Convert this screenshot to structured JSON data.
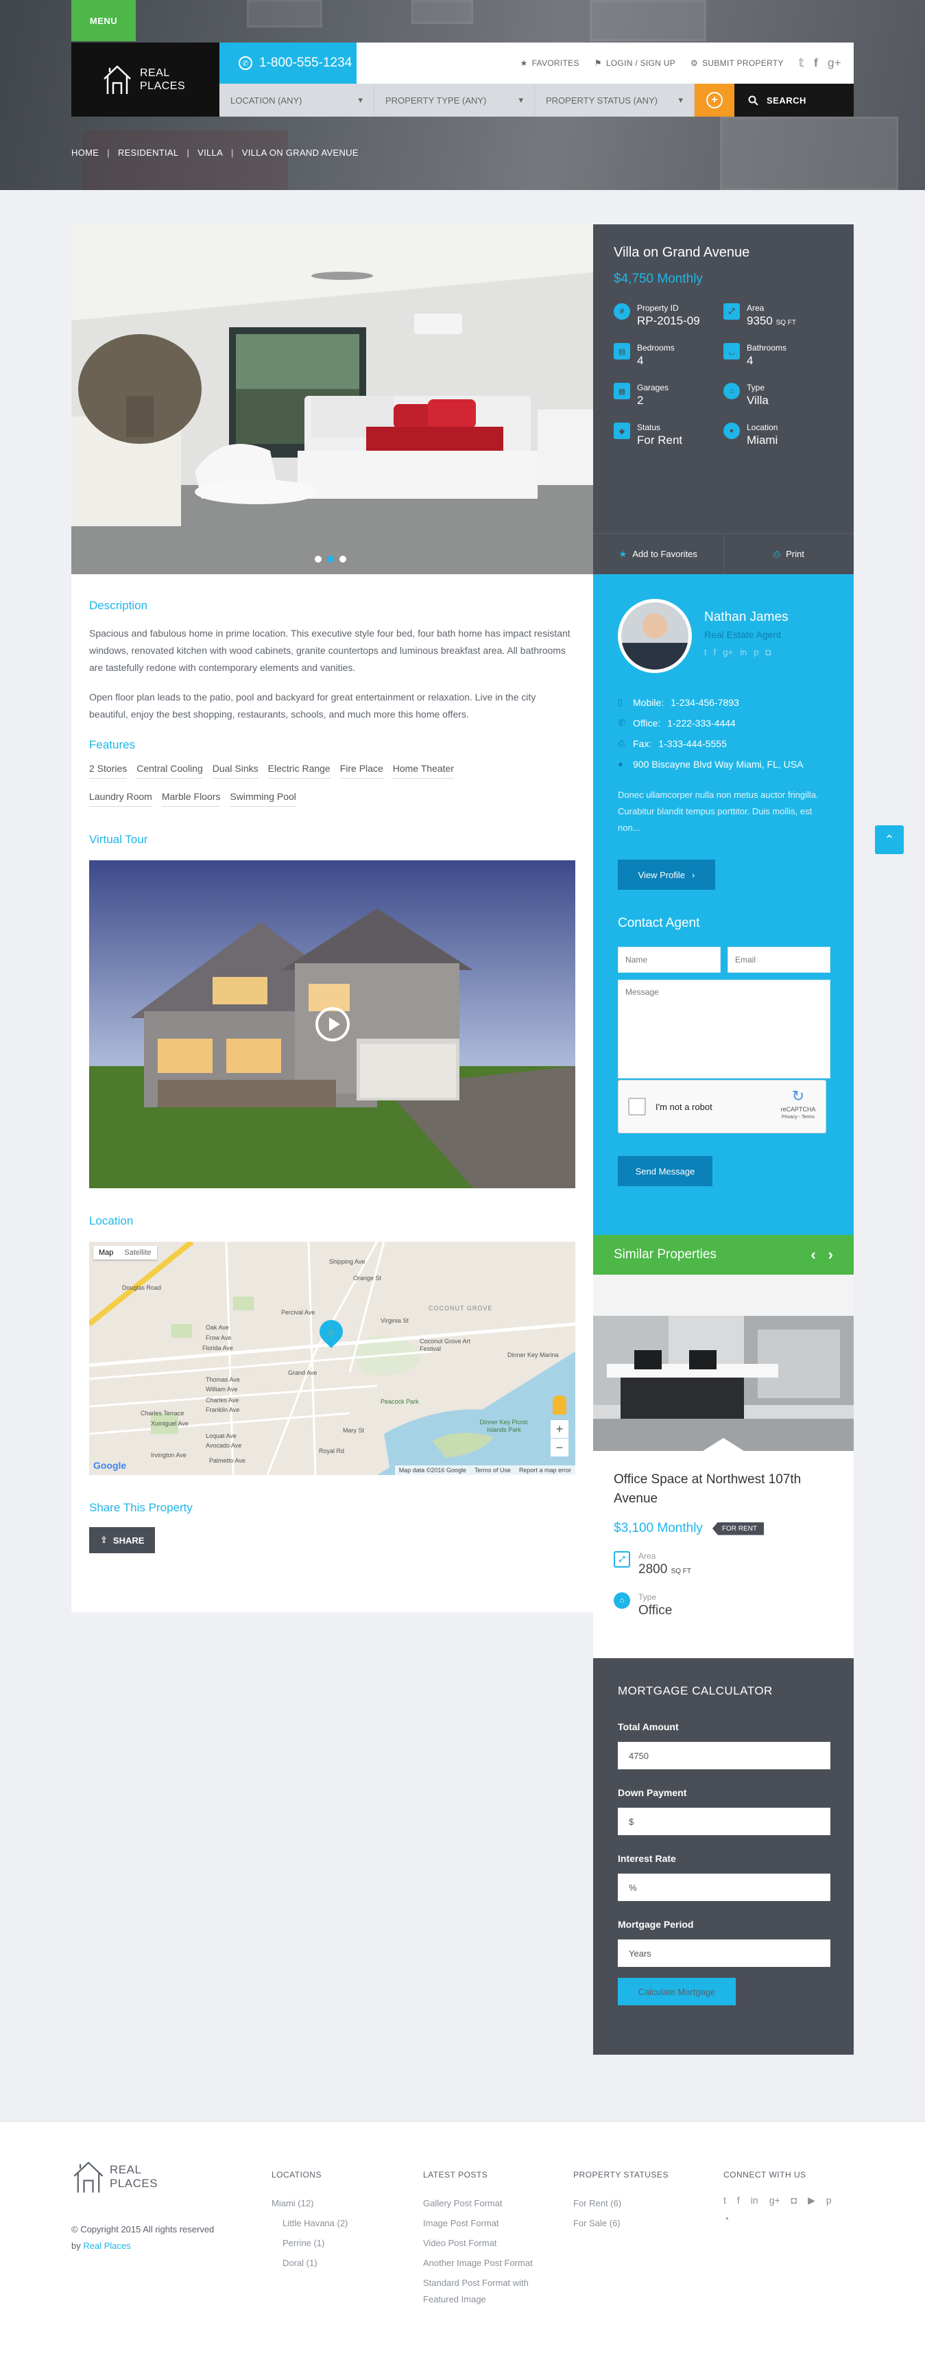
{
  "header": {
    "menu_label": "MENU",
    "logo_line1": "REAL",
    "logo_line2": "PLACES",
    "phone": "1-800-555-1234",
    "nav": [
      {
        "icon": "star-icon",
        "label": "FAVORITES"
      },
      {
        "icon": "user-icon",
        "label": "LOGIN / SIGN UP"
      },
      {
        "icon": "gear-icon",
        "label": "SUBMIT PROPERTY"
      }
    ],
    "social_icons": [
      "twitter-icon",
      "facebook-icon",
      "google-plus-icon"
    ],
    "search": {
      "location": "LOCATION (ANY)",
      "type": "PROPERTY TYPE (ANY)",
      "status": "PROPERTY STATUS (ANY)",
      "button": "SEARCH"
    },
    "breadcrumbs": [
      "HOME",
      "RESIDENTIAL",
      "VILLA",
      "VILLA ON GRAND AVENUE"
    ]
  },
  "property": {
    "title": "Villa on Grand Avenue",
    "price": "$4,750 Monthly",
    "slides": 3,
    "active_slide": 2,
    "meta": [
      {
        "icon": "id-icon",
        "label": "Property ID",
        "value": "RP-2015-09",
        "unit": ""
      },
      {
        "icon": "area-icon",
        "label": "Area",
        "value": "9350",
        "unit": "SQ FT"
      },
      {
        "icon": "bedroom-icon",
        "label": "Bedrooms",
        "value": "4",
        "unit": ""
      },
      {
        "icon": "bathroom-icon",
        "label": "Bathrooms",
        "value": "4",
        "unit": ""
      },
      {
        "icon": "garage-icon",
        "label": "Garages",
        "value": "2",
        "unit": ""
      },
      {
        "icon": "home-type-icon",
        "label": "Type",
        "value": "Villa",
        "unit": ""
      },
      {
        "icon": "tag-icon",
        "label": "Status",
        "value": "For Rent",
        "unit": ""
      },
      {
        "icon": "location-icon",
        "label": "Location",
        "value": "Miami",
        "unit": ""
      }
    ],
    "actions": {
      "favorite": "Add to Favorites",
      "print": "Print"
    }
  },
  "content": {
    "description_title": "Description",
    "description_p1": "Spacious and fabulous home in prime location. This executive style four bed, four bath home has impact resistant windows, renovated kitchen with wood cabinets, granite countertops and luminous breakfast area. All bathrooms are tastefully redone with contemporary elements and vanities.",
    "description_p2": "Open floor plan leads to the patio, pool and backyard for great entertainment or relaxation. Live in the city beautiful, enjoy the best shopping, restaurants, schools, and much more this home offers.",
    "features_title": "Features",
    "features": [
      "2 Stories",
      "Central Cooling",
      "Dual Sinks",
      "Electric Range",
      "Fire Place",
      "Home Theater",
      "Laundry Room",
      "Marble Floors",
      "Swimming Pool"
    ],
    "tour_title": "Virtual Tour",
    "location_title": "Location",
    "map": {
      "tab_map": "Map",
      "tab_satellite": "Satellite",
      "streets": [
        "Douglas Road",
        "Grand Ave",
        "Oak Ave",
        "Frow Ave",
        "Florida Ave",
        "Thomas Ave",
        "William Ave",
        "Charles Ave",
        "Franklin Ave",
        "Xumiguel Ave",
        "Loquat Ave",
        "Avocado Ave",
        "Irvington Ave",
        "Palmetto Ave",
        "Percival Ave",
        "Shipping Ave",
        "Orange St",
        "Charles Terrace",
        "Virginia St",
        "Mary St",
        "Royal Rd",
        "Peacock Park",
        "Coconut Grove Art Festival",
        "Dinner Key Marina",
        "Dinner Key Picnic Islands Park"
      ],
      "area_label": "COCONUT GROVE",
      "attribution": "Map data ©2016 Google",
      "terms": "Terms of Use",
      "report": "Report a map error",
      "brand": "Google"
    },
    "share_title": "Share This Property",
    "share_button": "SHARE"
  },
  "agent": {
    "name": "Nathan James",
    "role": "Real Estate Agent",
    "social_icons": [
      "twitter-icon",
      "facebook-icon",
      "google-plus-icon",
      "linkedin-icon",
      "pinterest-icon",
      "instagram-icon"
    ],
    "mobile_label": "Mobile:",
    "mobile": "1-234-456-7893",
    "office_label": "Office:",
    "office": "1-222-333-4444",
    "fax_label": "Fax:",
    "fax": "1-333-444-5555",
    "address": "900 Biscayne Blvd Way Miami, FL, USA",
    "bio": "Donec ullamcorper nulla non metus auctor fringilla. Curabitur blandit tempus porttitor. Duis mollis, est non...",
    "view_profile": "View Profile",
    "contact_title": "Contact Agent",
    "name_placeholder": "Name",
    "email_placeholder": "Email",
    "message_placeholder": "Message",
    "captcha_text": "I'm not a robot",
    "captcha_brand": "reCAPTCHA",
    "captcha_links": "Privacy - Terms",
    "send": "Send Message"
  },
  "similar": {
    "title": "Similar Properties",
    "name": "Office Space at Northwest 107th Avenue",
    "price": "$3,100 Monthly",
    "badge": "FOR RENT",
    "area_label": "Area",
    "area_value": "2800",
    "area_unit": "SQ FT",
    "type_label": "Type",
    "type_value": "Office"
  },
  "mortgage": {
    "title": "MORTGAGE CALCULATOR",
    "total_label": "Total Amount",
    "total_value": "4750",
    "down_label": "Down Payment",
    "down_value": "$",
    "rate_label": "Interest Rate",
    "rate_value": "%",
    "period_label": "Mortgage Period",
    "period_value": "Years",
    "button": "Calculate Mortgage"
  },
  "footer": {
    "logo_line1": "REAL",
    "logo_line2": "PLACES",
    "copyright": "© Copyright 2015 All rights reserved",
    "by": "by",
    "by_link": "Real Places",
    "locations_title": "LOCATIONS",
    "locations": [
      "Miami (12)",
      "Little Havana (2)",
      "Perrine (1)",
      "Doral (1)"
    ],
    "posts_title": "LATEST POSTS",
    "posts": [
      "Gallery Post Format",
      "Image Post Format",
      "Video Post Format",
      "Another Image Post Format",
      "Standard Post Format with",
      "Featured Image"
    ],
    "statuses_title": "PROPERTY STATUSES",
    "statuses": [
      "For Rent (6)",
      "For Sale (6)"
    ],
    "connect_title": "CONNECT WITH US",
    "connect_icons": [
      "twitter-icon",
      "facebook-icon",
      "linkedin-icon",
      "google-plus-icon",
      "instagram-icon",
      "youtube-icon",
      "pinterest-icon",
      "rss-icon"
    ]
  },
  "colors": {
    "accent": "#1eb6e8",
    "green": "#4db848",
    "orange": "#f59a23",
    "dark": "#4a4f57"
  }
}
